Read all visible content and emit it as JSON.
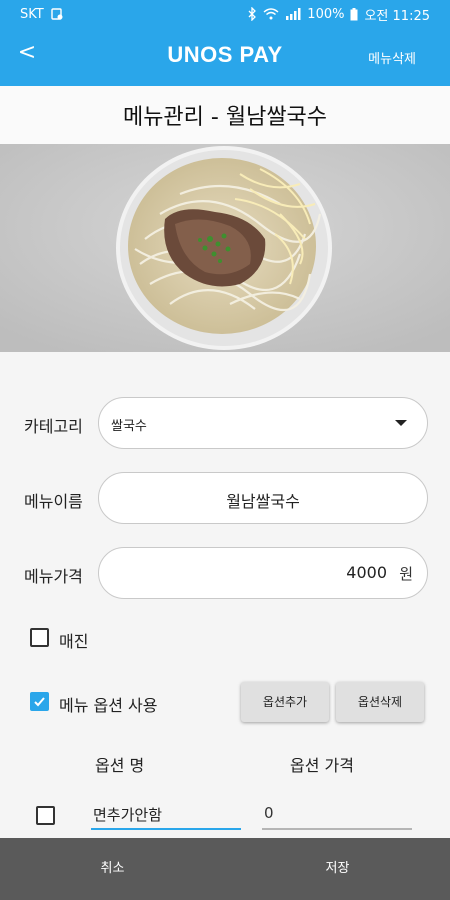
{
  "status_bar": {
    "carrier": "SKT",
    "battery": "100%",
    "time": "오전 11:25"
  },
  "app_bar": {
    "back": "<",
    "title": "UNOS PAY",
    "action": "메뉴삭제"
  },
  "page_title": "메뉴관리 - 월남쌀국수",
  "form": {
    "category_label": "카테고리",
    "category_value": "쌀국수",
    "name_label": "메뉴이름",
    "name_value": "월남쌀국수",
    "price_label": "메뉴가격",
    "price_value": "4000",
    "price_unit": "원",
    "soldout_label": "매진",
    "soldout_checked": false,
    "use_option_label": "메뉴 옵션 사용",
    "use_option_checked": true,
    "add_option": "옵션추가",
    "delete_option": "옵션삭제",
    "option_name_header": "옵션 명",
    "option_price_header": "옵션 가격",
    "options": [
      {
        "name": "면추가안함",
        "price": "0",
        "checked": false
      }
    ]
  },
  "bottom": {
    "cancel": "취소",
    "save": "저장"
  },
  "colors": {
    "primary": "#2aa6ea",
    "bottom_bar": "#5a5a5a"
  }
}
